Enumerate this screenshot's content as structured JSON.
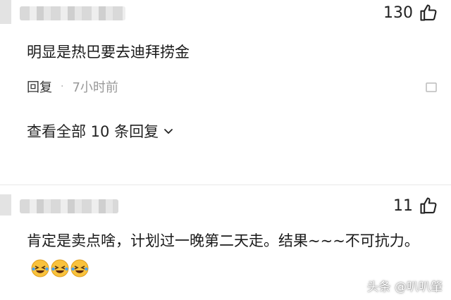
{
  "comment1": {
    "likes": "130",
    "text": "明显是热巴要去迪拜捞金",
    "reply_label": "回复",
    "separator": "·",
    "time": "7小时前",
    "expand_label": "查看全部 10 条回复"
  },
  "comment2": {
    "likes": "11",
    "text": "肯定是卖点啥，计划过一晚第二天走。结果~~~不可抗力。",
    "emojis": [
      "laughing-crying-emoji",
      "laughing-crying-emoji",
      "laughing-crying-emoji"
    ]
  },
  "watermark": "头条 @叭叭肇",
  "icons": {
    "like": "thumbs-up-icon",
    "more": "flag-outline-icon",
    "expand": "chevron-down-icon"
  }
}
